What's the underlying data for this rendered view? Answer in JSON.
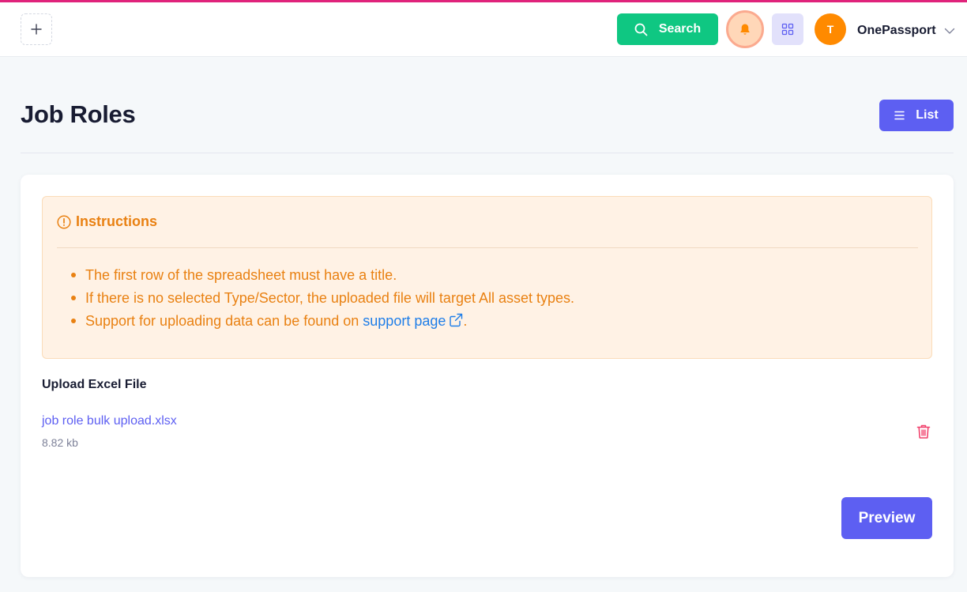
{
  "header": {
    "add_icon": "plus-icon",
    "search_label": "Search",
    "search_icon": "search-icon",
    "notification_icon": "bell-icon",
    "apps_icon": "grid-icon",
    "avatar_initial": "T",
    "user_name": "OnePassport",
    "user_menu_icon": "chevron-down-icon"
  },
  "page": {
    "title": "Job Roles",
    "list_button_label": "List",
    "list_icon": "menu-lines-icon"
  },
  "instructions": {
    "title": "Instructions",
    "icon": "exclamation-circle-icon",
    "items": [
      {
        "text": "The first row of the spreadsheet must have a title."
      },
      {
        "text": "If there is no selected Type/Sector, the uploaded file will target All asset types."
      },
      {
        "text": "Support for uploading data can be found on ",
        "link_text": "support page",
        "link_icon": "external-link-icon",
        "suffix": "."
      }
    ]
  },
  "upload": {
    "label": "Upload Excel File",
    "file_name": "job role bulk upload.xlsx",
    "file_size": "8.82 kb",
    "delete_icon": "trash-icon"
  },
  "actions": {
    "preview_label": "Preview"
  },
  "colors": {
    "accent_bar": "#e0237b",
    "primary": "#5d5ff2",
    "success": "#0fc782",
    "warning_text": "#e98112",
    "warning_bg": "#fff2e5",
    "avatar_bg": "#ff8a00",
    "danger": "#f1416c",
    "link": "#1f7ee8"
  }
}
